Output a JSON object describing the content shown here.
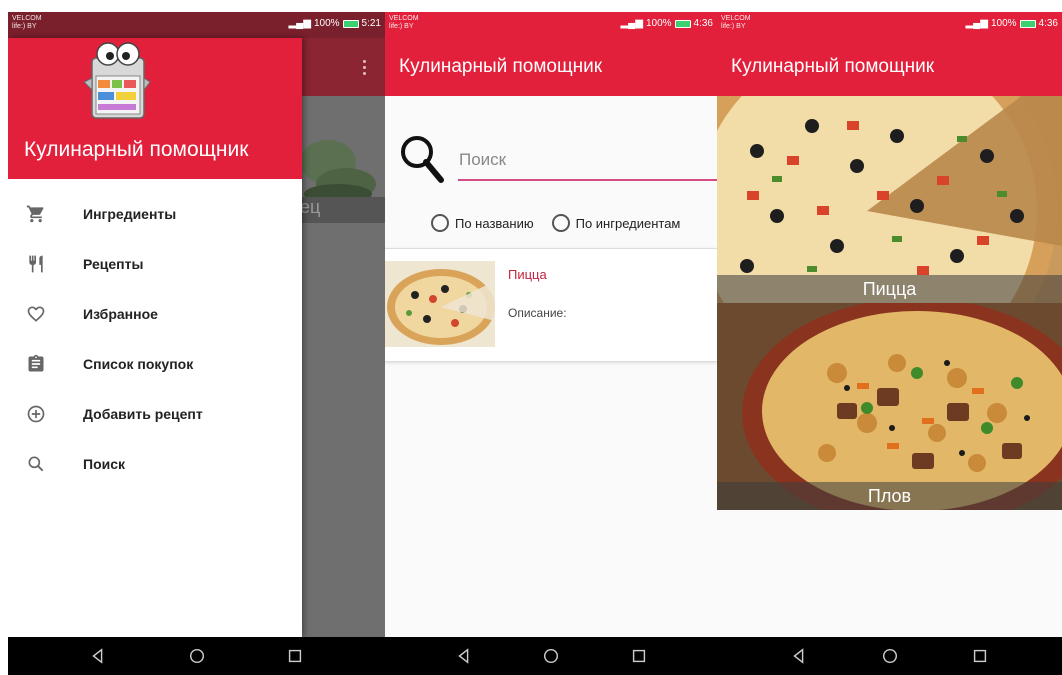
{
  "screens": [
    {
      "status": {
        "carrier_line1": "VELCOM",
        "carrier_line2": "life:) BY",
        "battery": "100%",
        "time": "5:21"
      },
      "background_title_fragment": "к",
      "background_label_fragment": "ец",
      "drawer": {
        "title": "Кулинарный помощник",
        "items": [
          {
            "icon": "cart-icon",
            "label": "Ингредиенты"
          },
          {
            "icon": "fork-knife-icon",
            "label": "Рецепты"
          },
          {
            "icon": "heart-icon",
            "label": "Избранное"
          },
          {
            "icon": "clipboard-icon",
            "label": "Список покупок"
          },
          {
            "icon": "add-circle-icon",
            "label": "Добавить рецепт"
          },
          {
            "icon": "search-icon",
            "label": "Поиск"
          }
        ]
      }
    },
    {
      "status": {
        "carrier_line1": "VELCOM",
        "carrier_line2": "life:) BY",
        "battery": "100%",
        "time": "4:36"
      },
      "appbar_title": "Кулинарный помощник",
      "search": {
        "placeholder": "Поиск",
        "value": ""
      },
      "radios": [
        {
          "label": "По названию",
          "checked": false
        },
        {
          "label": "По ингредиентам",
          "checked": false
        }
      ],
      "result": {
        "title": "Пицца",
        "description": "Описание:"
      }
    },
    {
      "status": {
        "carrier_line1": "VELCOM",
        "carrier_line2": "life:) BY",
        "battery": "100%",
        "time": "4:36"
      },
      "appbar_title": "Кулинарный помощник",
      "dishes": [
        {
          "name": "Пицца"
        },
        {
          "name": "Плов"
        }
      ]
    }
  ],
  "colors": {
    "primary": "#e2203b",
    "accent": "#d64a86",
    "title_red": "#c4253f"
  },
  "navbar_icons": [
    "back-icon",
    "home-icon",
    "recents-icon"
  ]
}
